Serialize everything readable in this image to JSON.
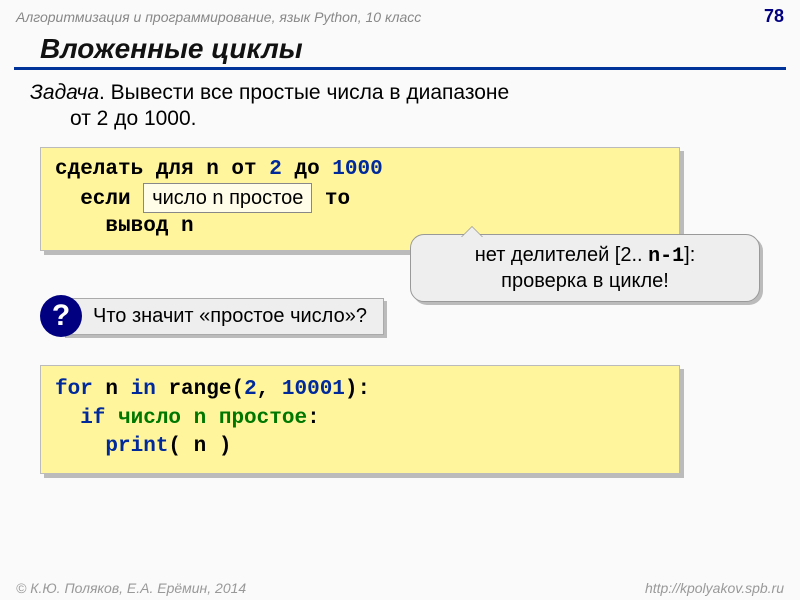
{
  "header": {
    "course": "Алгоритмизация и программирование, язык Python, 10 класс",
    "page_number": "78"
  },
  "title": "Вложенные циклы",
  "task": {
    "label": "Задача",
    "text_line1": ". Вывести все простые числа в диапазоне",
    "text_line2": "от 2 до 1000."
  },
  "pseudo": {
    "l1a": "сделать для n от ",
    "l1b": "2",
    "l1c": " до ",
    "l1d": "1000",
    "l2a": "  если ",
    "l2_box": "число n простое",
    "l2b": " то",
    "l3": "    вывод n"
  },
  "callout": {
    "line1a": "нет делителей [2.. ",
    "line1b": "n-1",
    "line1c": "]:",
    "line2": "проверка в цикле!"
  },
  "question_mark": "?",
  "question_text": "Что значит «простое число»?",
  "python": {
    "l1": {
      "a": "for",
      "b": " n ",
      "c": "in",
      "d": " range(",
      "e": "2",
      "f": ", ",
      "g": "10001",
      "h": "):"
    },
    "l2": {
      "a": "  if",
      "b": " число n простое",
      "c": ":"
    },
    "l3": {
      "a": "    print",
      "b": "( n )"
    }
  },
  "footer": {
    "left": "© К.Ю. Поляков, Е.А. Ерёмин, 2014",
    "right": "http://kpolyakov.spb.ru"
  }
}
